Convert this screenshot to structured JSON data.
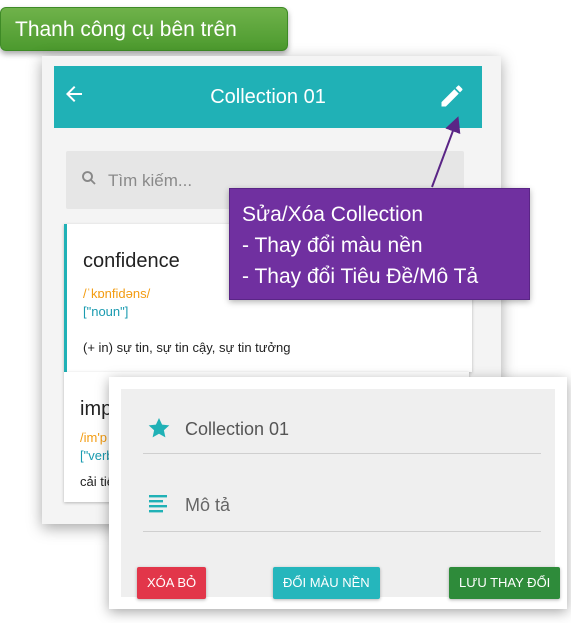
{
  "toolbar_label": "Thanh công cụ bên trên",
  "appbar": {
    "title": "Collection 01",
    "back_icon": "arrow-left-icon",
    "edit_icon": "pencil-icon",
    "color": "#20b1b6"
  },
  "search": {
    "placeholder": "Tìm kiếm..."
  },
  "words": [
    {
      "word": "confidence",
      "phonetic": "/ˈkɒnfidəns/",
      "pos": "[\"noun\"]",
      "meaning": "(+ in) sự tin, sự tin cậy, sự tin tưởng"
    },
    {
      "word": "imp",
      "phonetic": "/im'p",
      "pos": "[\"verb",
      "meaning": "cải tiế"
    }
  ],
  "callout": {
    "lines": [
      "Sửa/Xóa Collection",
      "- Thay đổi màu nền",
      "- Thay đổi Tiêu Đề/Mô Tả"
    ],
    "color": "#7030a0"
  },
  "dialog": {
    "title_value": "Collection 01",
    "description_placeholder": "Mô tả",
    "buttons": {
      "delete": "XÓA BỎ",
      "change_color": "ĐỔI MÀU NỀN",
      "save": "LƯU THAY ĐỔI"
    },
    "colors": {
      "delete": "#e2364a",
      "change_color": "#25b6bc",
      "save": "#2e8b3a"
    }
  }
}
